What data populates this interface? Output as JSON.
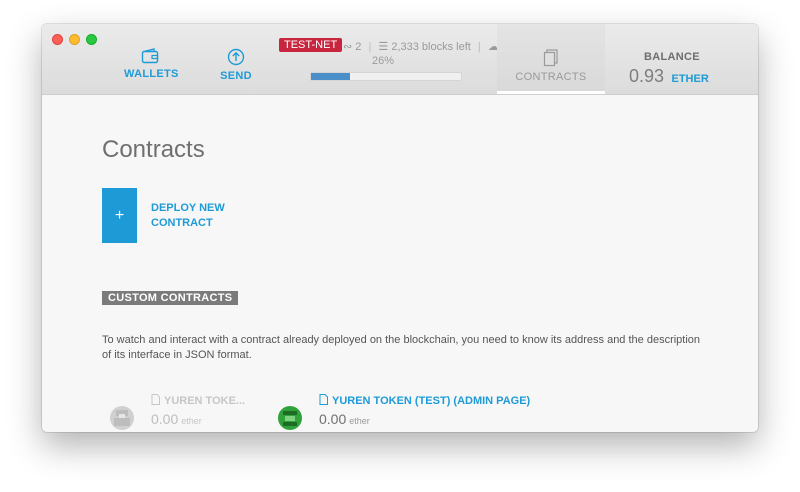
{
  "header": {
    "nav": {
      "wallets": "WALLETS",
      "send": "SEND",
      "contracts": "CONTRACTS"
    },
    "network_badge": "TEST-NET",
    "peers": "2",
    "blocks_left": "2,333 blocks left",
    "sync_percent_label": "26%",
    "sync_progress": 0.26,
    "balance_label": "BALANCE",
    "balance_amount": "0.93",
    "balance_unit": "ETHER"
  },
  "main": {
    "title": "Contracts",
    "deploy_plus": "+",
    "deploy_line1": "DEPLOY NEW",
    "deploy_line2": "CONTRACT",
    "section_title": "CUSTOM CONTRACTS",
    "description": "To watch and interact with a contract already deployed on the blockchain, you need to know its address and the description of its interface in JSON format.",
    "contracts": [
      {
        "name": "YUREN TOKE...",
        "amount": "0.00",
        "unit": "ether"
      },
      {
        "name": "YUREN TOKEN (TEST) (ADMIN PAGE)",
        "amount": "0.00",
        "unit": "ether"
      }
    ]
  },
  "colors": {
    "accent": "#1e9bd6",
    "testnet": "#c8253e",
    "badge": "#7b7b7b"
  }
}
